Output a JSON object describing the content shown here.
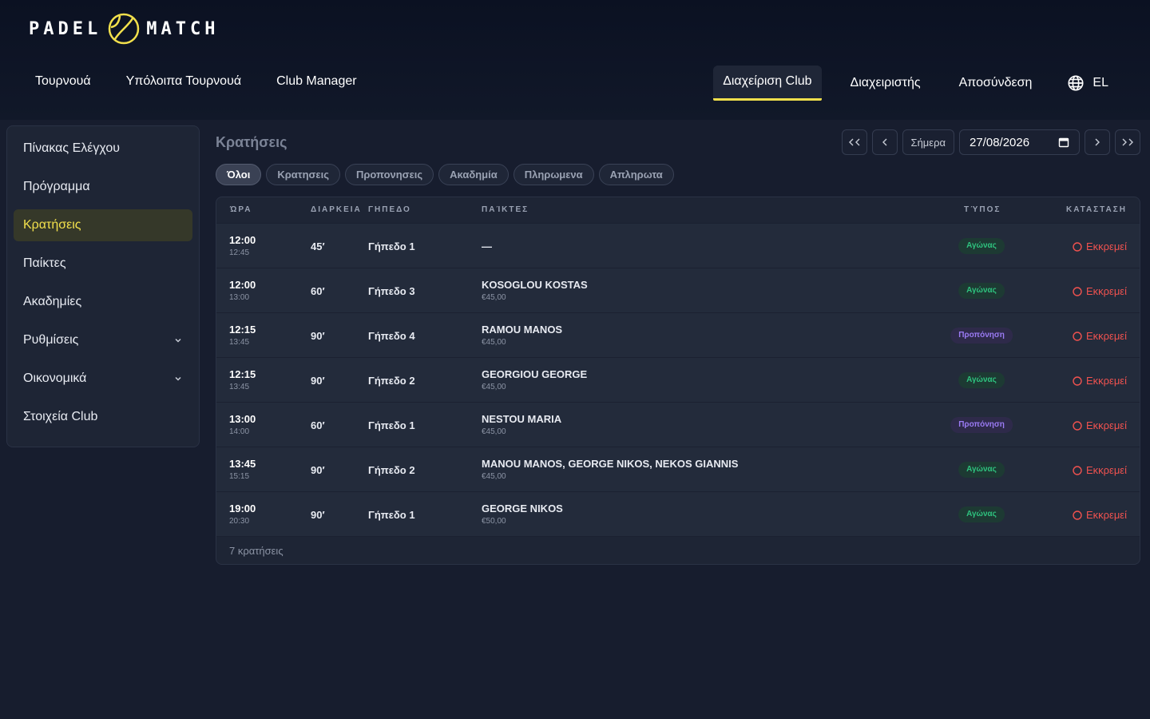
{
  "brand": {
    "left": "PADEL",
    "right": "MATCH"
  },
  "nav_left": [
    "Τουρνουά",
    "Υπόλοιπα Τουρνουά",
    "Club Manager"
  ],
  "nav_right": {
    "club": "Διαχείριση Club",
    "admin": "Διαχειριστής",
    "logout": "Αποσύνδεση",
    "lang": "EL"
  },
  "sidebar": {
    "items": [
      {
        "label": "Πίνακας Ελέγχου"
      },
      {
        "label": "Πρόγραμμα"
      },
      {
        "label": "Κρατήσεις"
      },
      {
        "label": "Παίκτες"
      },
      {
        "label": "Ακαδημίες"
      },
      {
        "label": "Ρυθμίσεις"
      },
      {
        "label": "Οικονομικά"
      },
      {
        "label": "Στοιχεία Club"
      }
    ]
  },
  "page": {
    "title": "Κρατήσεις"
  },
  "date": {
    "today_label": "Σήμερα",
    "value": "27/08/2026"
  },
  "filters": [
    "Όλοι",
    "Κρατησεις",
    "Προπονησεις",
    "Ακαδημία",
    "Πληρωμενα",
    "Απληρωτα"
  ],
  "table": {
    "headers": {
      "time": "ΏΡΑ",
      "duration": "ΔΙΑΡΚΕΙΑ",
      "court": "ΓΗΠΕΔΟ",
      "players": "ΠΑΊΚΤΕΣ",
      "type": "ΤΎΠΟΣ",
      "status": "ΚΑΤΑΣΤΑΣΗ"
    },
    "rows": [
      {
        "start": "12:00",
        "end": "12:45",
        "duration": "45′",
        "court": "Γήπεδο 1",
        "players": "—",
        "price": "",
        "type": "Αγώνας",
        "status": "Εκκρεμεί"
      },
      {
        "start": "12:00",
        "end": "13:00",
        "duration": "60′",
        "court": "Γήπεδο 3",
        "players": "KOSOGLOU KOSTAS",
        "price": "€45,00",
        "type": "Αγώνας",
        "status": "Εκκρεμεί"
      },
      {
        "start": "12:15",
        "end": "13:45",
        "duration": "90′",
        "court": "Γήπεδο 4",
        "players": "RAMOU MANOS",
        "price": "€45,00",
        "type": "Προπόνηση",
        "status": "Εκκρεμεί"
      },
      {
        "start": "12:15",
        "end": "13:45",
        "duration": "90′",
        "court": "Γήπεδο 2",
        "players": "GEORGIOU GEORGE",
        "price": "€45,00",
        "type": "Αγώνας",
        "status": "Εκκρεμεί"
      },
      {
        "start": "13:00",
        "end": "14:00",
        "duration": "60′",
        "court": "Γήπεδο 1",
        "players": "NESTOU MARIA",
        "price": "€45,00",
        "type": "Προπόνηση",
        "status": "Εκκρεμεί"
      },
      {
        "start": "13:45",
        "end": "15:15",
        "duration": "90′",
        "court": "Γήπεδο 2",
        "players": "MANOU MANOS, GEORGE NIKOS, NEKOS GIANNIS",
        "price": "€45,00",
        "type": "Αγώνας",
        "status": "Εκκρεμεί"
      },
      {
        "start": "19:00",
        "end": "20:30",
        "duration": "90′",
        "court": "Γήπεδο 1",
        "players": "GEORGE NIKOS",
        "price": "€50,00",
        "type": "Αγώνας",
        "status": "Εκκρεμεί"
      }
    ],
    "footer": "7 κρατήσεις"
  },
  "colors": {
    "accent": "#f2e04c",
    "match": "#2ec27e",
    "training": "#9b7bf5",
    "pending": "#f0524f"
  }
}
